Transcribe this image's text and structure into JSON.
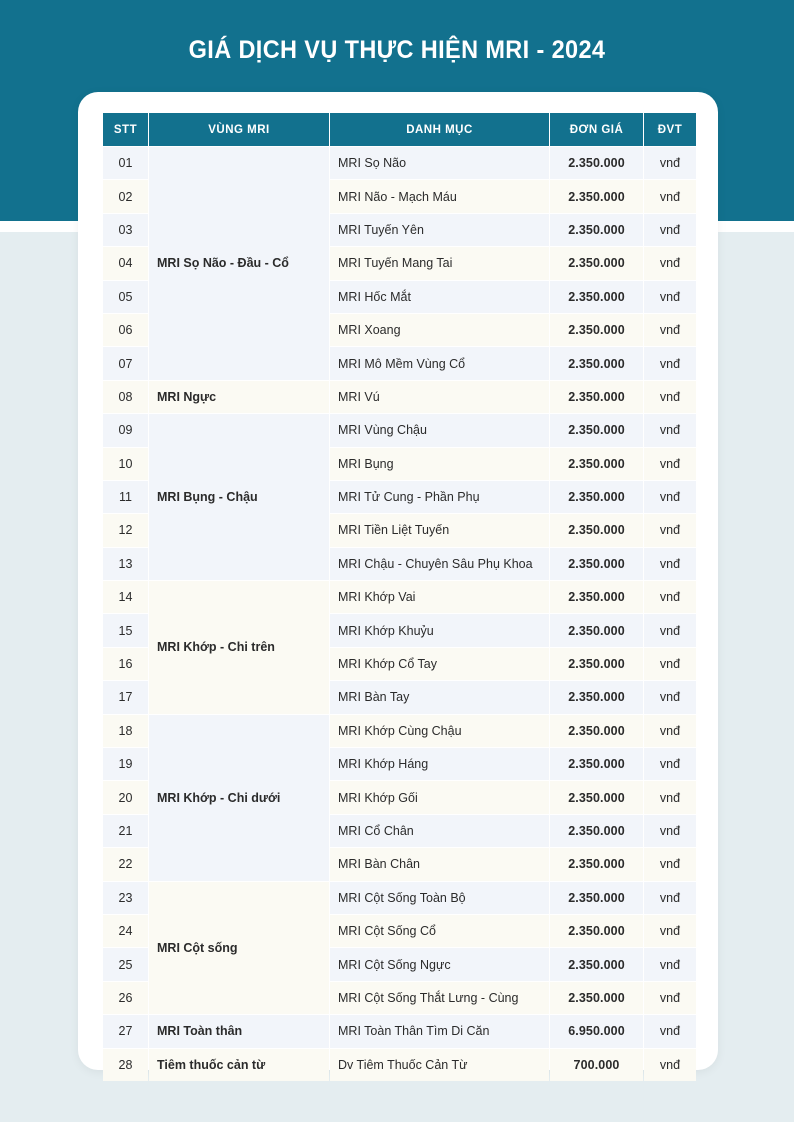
{
  "banner": {
    "title": "GIÁ DỊCH VỤ THỰC HIỆN MRI - 2024",
    "background_color": "#12718e"
  },
  "page": {
    "background_color": "#e4edf0",
    "card_color": "#ffffff",
    "accent_price_color": "#1260bd"
  },
  "table": {
    "columns": [
      {
        "key": "stt",
        "label": "STT"
      },
      {
        "key": "vung",
        "label": "VÙNG MRI"
      },
      {
        "key": "danh",
        "label": "DANH MỤC"
      },
      {
        "key": "gia",
        "label": "ĐƠN GIÁ"
      },
      {
        "key": "dvt",
        "label": "ĐVT"
      }
    ],
    "groups": [
      {
        "label": "MRI Sọ Não - Đầu - Cổ",
        "rows": [
          {
            "stt": "01",
            "danh": "MRI Sọ Não",
            "gia": "2.350.000",
            "dvt": "vnđ"
          },
          {
            "stt": "02",
            "danh": "MRI Não - Mạch Máu",
            "gia": "2.350.000",
            "dvt": "vnđ"
          },
          {
            "stt": "03",
            "danh": "MRI Tuyến Yên",
            "gia": "2.350.000",
            "dvt": "vnđ"
          },
          {
            "stt": "04",
            "danh": "MRI Tuyến Mang Tai",
            "gia": "2.350.000",
            "dvt": "vnđ"
          },
          {
            "stt": "05",
            "danh": "MRI Hốc Mắt",
            "gia": "2.350.000",
            "dvt": "vnđ"
          },
          {
            "stt": "06",
            "danh": "MRI Xoang",
            "gia": "2.350.000",
            "dvt": "vnđ"
          },
          {
            "stt": "07",
            "danh": "MRI Mô Mềm Vùng Cổ",
            "gia": "2.350.000",
            "dvt": "vnđ"
          }
        ]
      },
      {
        "label": "MRI Ngực",
        "rows": [
          {
            "stt": "08",
            "danh": "MRI Vú",
            "gia": "2.350.000",
            "dvt": "vnđ"
          }
        ]
      },
      {
        "label": "MRI Bụng - Chậu",
        "rows": [
          {
            "stt": "09",
            "danh": "MRI Vùng Chậu",
            "gia": "2.350.000",
            "dvt": "vnđ"
          },
          {
            "stt": "10",
            "danh": "MRI Bụng",
            "gia": "2.350.000",
            "dvt": "vnđ"
          },
          {
            "stt": "11",
            "danh": "MRI Tử Cung  - Phần Phụ",
            "gia": "2.350.000",
            "dvt": "vnđ"
          },
          {
            "stt": "12",
            "danh": "MRI Tiền Liệt Tuyến",
            "gia": "2.350.000",
            "dvt": "vnđ"
          },
          {
            "stt": "13",
            "danh": "MRI Chậu - Chuyên Sâu Phụ Khoa",
            "gia": "2.350.000",
            "dvt": "vnđ"
          }
        ]
      },
      {
        "label": "MRI Khớp - Chi trên",
        "rows": [
          {
            "stt": "14",
            "danh": "MRI Khớp Vai",
            "gia": "2.350.000",
            "dvt": "vnđ"
          },
          {
            "stt": "15",
            "danh": "MRI Khớp Khuỷu",
            "gia": "2.350.000",
            "dvt": "vnđ"
          },
          {
            "stt": "16",
            "danh": "MRI Khớp Cổ Tay",
            "gia": "2.350.000",
            "dvt": "vnđ"
          },
          {
            "stt": "17",
            "danh": "MRI Bàn Tay",
            "gia": "2.350.000",
            "dvt": "vnđ"
          }
        ]
      },
      {
        "label": "MRI Khớp - Chi dưới",
        "rows": [
          {
            "stt": "18",
            "danh": "MRI Khớp Cùng Chậu",
            "gia": "2.350.000",
            "dvt": "vnđ"
          },
          {
            "stt": "19",
            "danh": "MRI Khớp Háng",
            "gia": "2.350.000",
            "dvt": "vnđ"
          },
          {
            "stt": "20",
            "danh": "MRI Khớp Gối",
            "gia": "2.350.000",
            "dvt": "vnđ"
          },
          {
            "stt": "21",
            "danh": "MRI Cổ Chân",
            "gia": "2.350.000",
            "dvt": "vnđ"
          },
          {
            "stt": "22",
            "danh": "MRI Bàn Chân",
            "gia": "2.350.000",
            "dvt": "vnđ"
          }
        ]
      },
      {
        "label": "MRI Cột sống",
        "rows": [
          {
            "stt": "23",
            "danh": "MRI Cột Sống Toàn Bộ",
            "gia": "2.350.000",
            "dvt": "vnđ"
          },
          {
            "stt": "24",
            "danh": "MRI Cột Sống Cổ",
            "gia": "2.350.000",
            "dvt": "vnđ"
          },
          {
            "stt": "25",
            "danh": "MRI Cột Sống Ngực",
            "gia": "2.350.000",
            "dvt": "vnđ"
          },
          {
            "stt": "26",
            "danh": "MRI Cột Sống Thắt Lưng - Cùng",
            "gia": "2.350.000",
            "dvt": "vnđ"
          }
        ]
      },
      {
        "label": "MRI Toàn thân",
        "rows": [
          {
            "stt": "27",
            "danh": "MRI Toàn Thân Tìm Di Căn",
            "gia": "6.950.000",
            "dvt": "vnđ"
          }
        ]
      },
      {
        "label": "Tiêm thuốc cản từ",
        "rows": [
          {
            "stt": "28",
            "danh": "Dv Tiêm Thuốc Cản Từ",
            "gia": "700.000",
            "dvt": "vnđ"
          }
        ]
      }
    ]
  }
}
